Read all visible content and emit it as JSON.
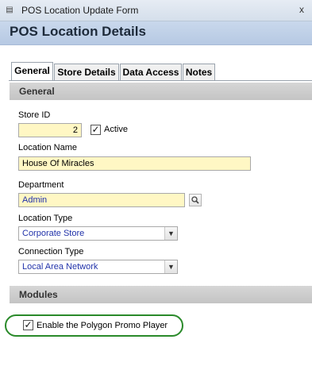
{
  "window": {
    "title": "POS Location Update Form",
    "close_label": "x"
  },
  "header": {
    "title": "POS Location Details"
  },
  "tabs": [
    {
      "label": "General",
      "active": true
    },
    {
      "label": "Store Details",
      "active": false
    },
    {
      "label": "Data Access",
      "active": false
    },
    {
      "label": "Notes",
      "active": false
    }
  ],
  "sections": {
    "general": "General",
    "modules": "Modules"
  },
  "form": {
    "store_id": {
      "label": "Store ID",
      "value": "2"
    },
    "active": {
      "label": "Active",
      "checked": true
    },
    "location_name": {
      "label": "Location Name",
      "value": "House Of Miracles"
    },
    "department": {
      "label": "Department",
      "value": "Admin"
    },
    "location_type": {
      "label": "Location Type",
      "value": "Corporate Store"
    },
    "connection_type": {
      "label": "Connection Type",
      "value": "Local Area Network"
    }
  },
  "modules": {
    "polygon_promo": {
      "label": "Enable the Polygon Promo Player",
      "checked": true
    }
  },
  "colors": {
    "required_field_bg": "#fff7c4",
    "header_bg": "#b6c9e3",
    "highlight_oval": "#2a8a2a",
    "lookup_text": "#2233aa"
  },
  "icons": {
    "app": "form-icon",
    "lookup": "magnifier-icon",
    "dropdown": "chevron-down-icon",
    "check": "checkmark-icon"
  }
}
